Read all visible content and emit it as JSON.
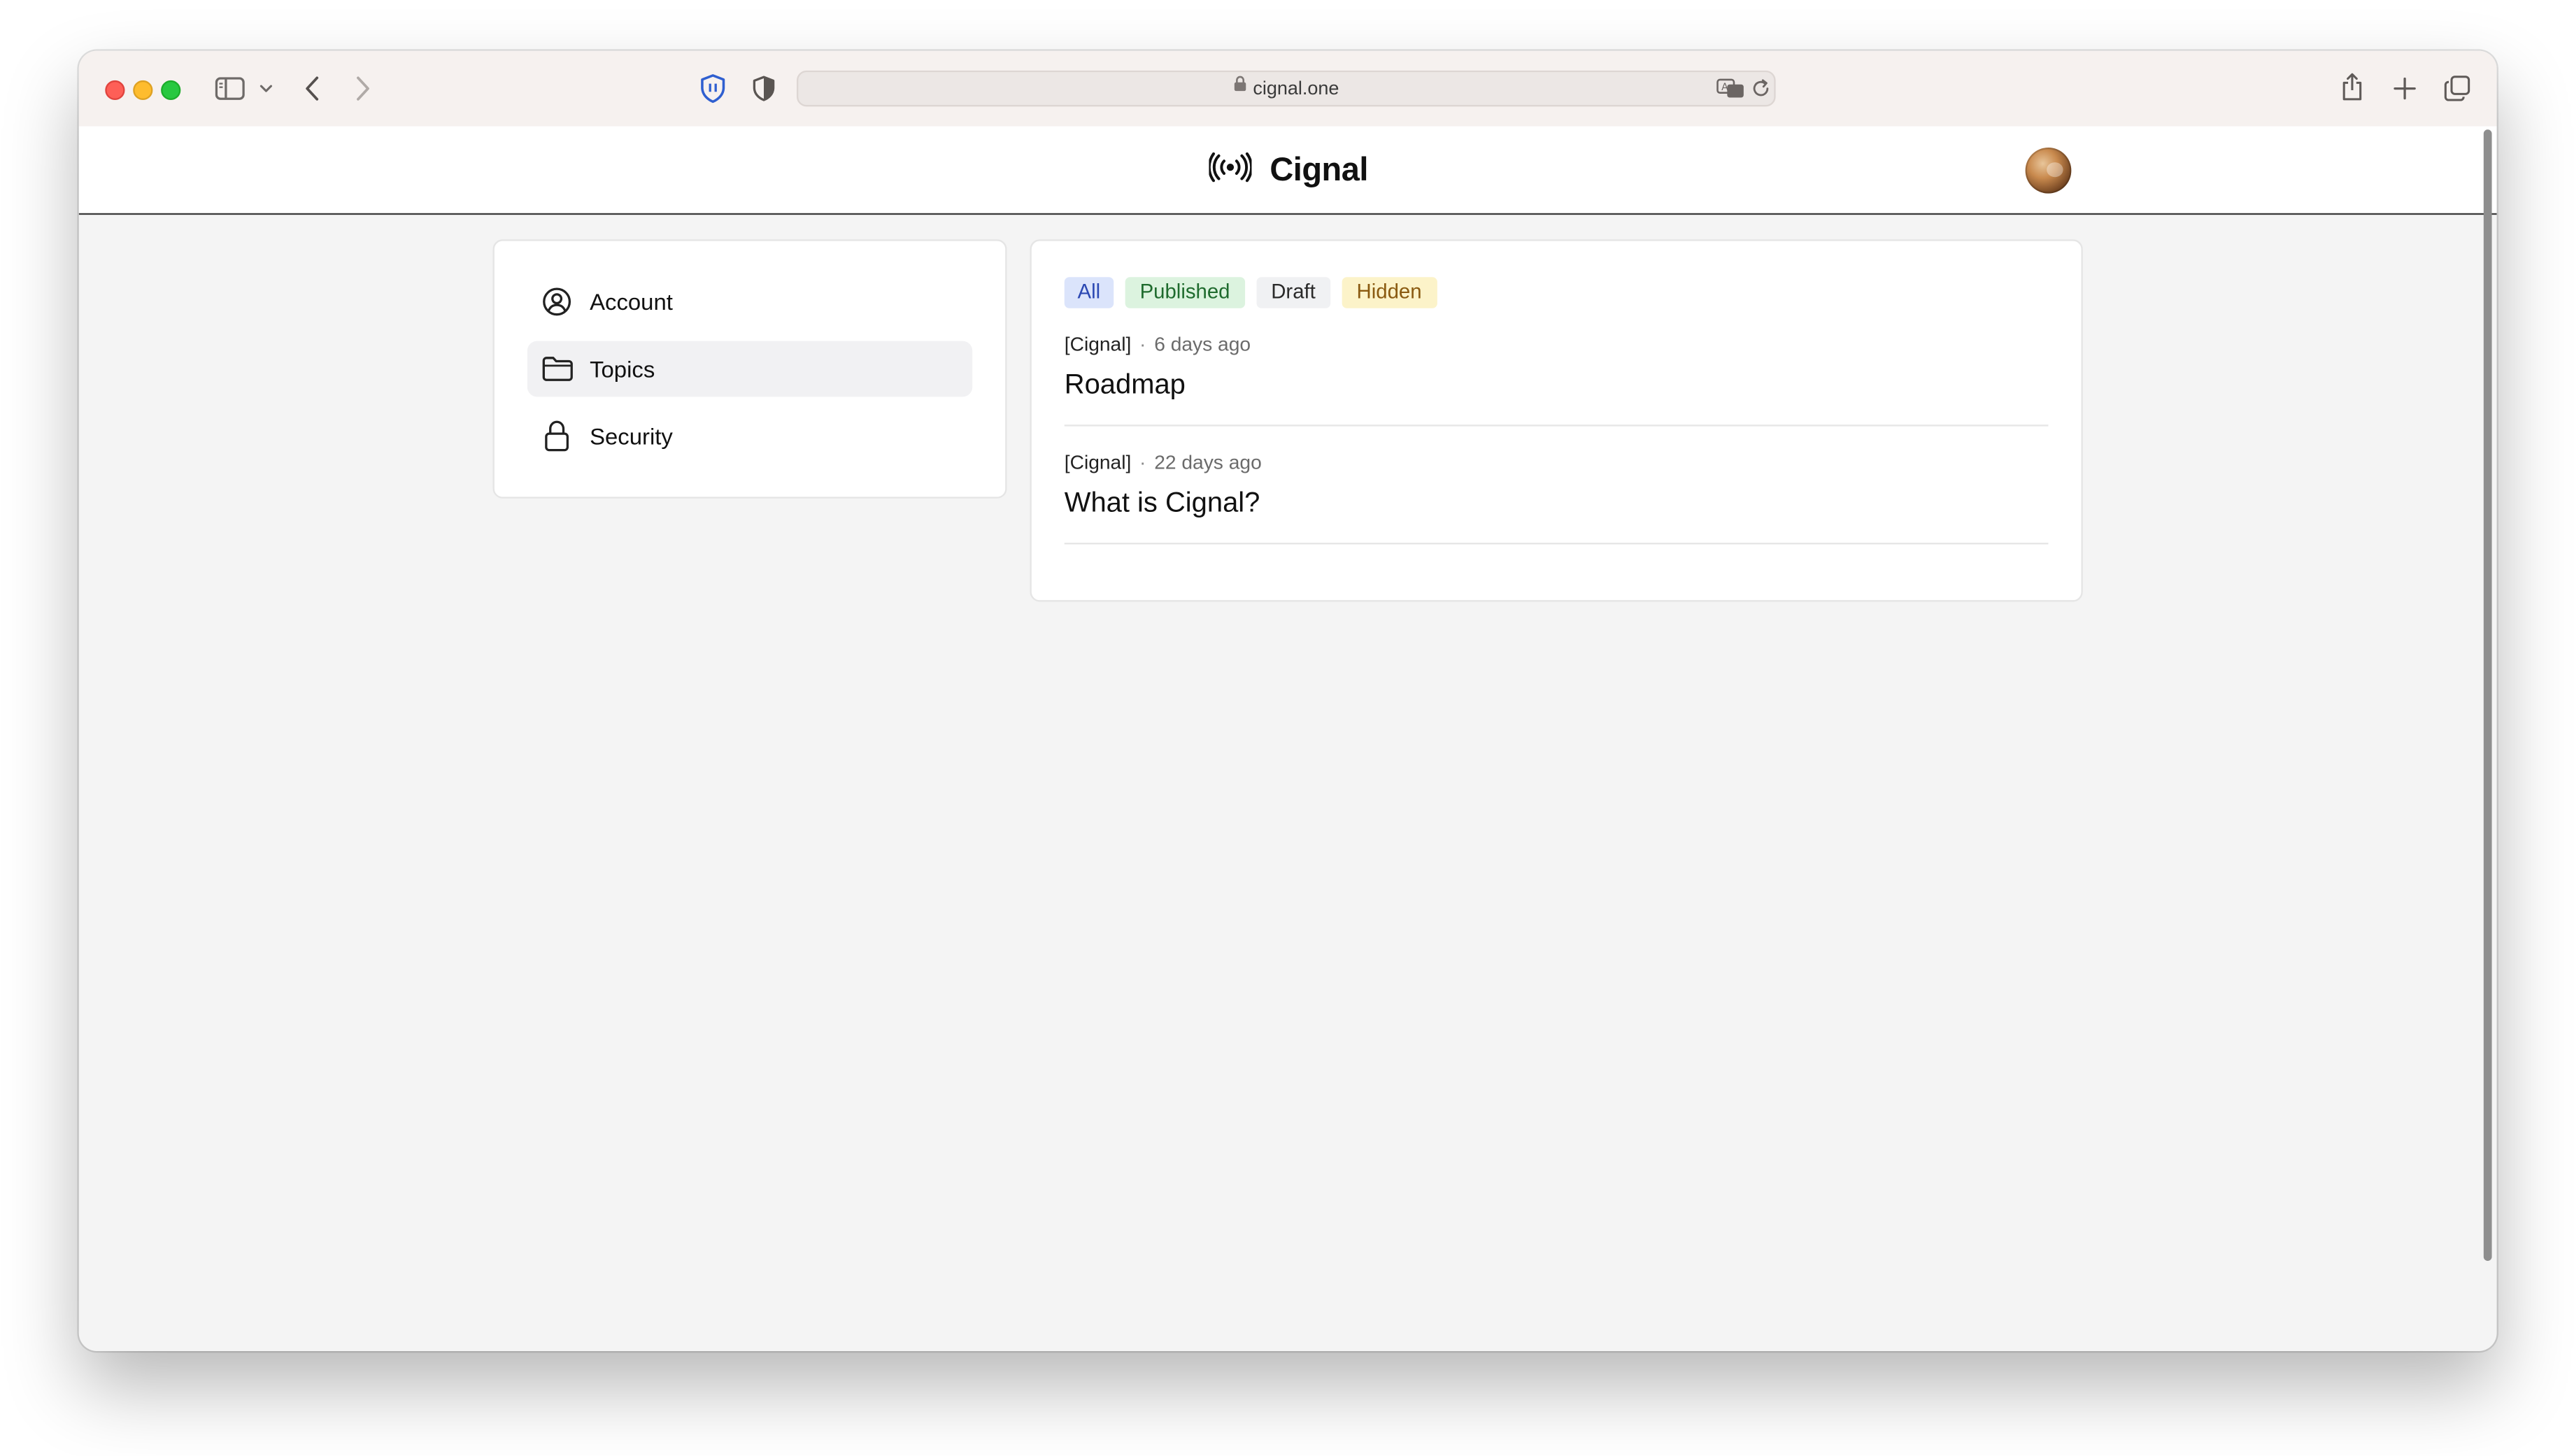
{
  "browser": {
    "url": "cignal.one"
  },
  "app": {
    "brand_name": "Cignal"
  },
  "sidebar": {
    "items": [
      {
        "label": "Account",
        "icon": "user-circle-icon",
        "active": false
      },
      {
        "label": "Topics",
        "icon": "folder-icon",
        "active": true
      },
      {
        "label": "Security",
        "icon": "lock-icon",
        "active": false
      }
    ]
  },
  "filters": {
    "all": "All",
    "published": "Published",
    "draft": "Draft",
    "hidden": "Hidden",
    "selected": "All"
  },
  "posts": [
    {
      "source": "[Cignal]",
      "separator": "·",
      "age": "6 days ago",
      "title": "Roadmap"
    },
    {
      "source": "[Cignal]",
      "separator": "·",
      "age": "22 days ago",
      "title": "What is Cignal?"
    }
  ],
  "colors": {
    "filter_all": "#dbe4fb",
    "filter_published": "#dcf3df",
    "filter_draft": "#f0f1f3",
    "filter_hidden": "#fcf3c9",
    "page_background": "#f4f4f4"
  }
}
